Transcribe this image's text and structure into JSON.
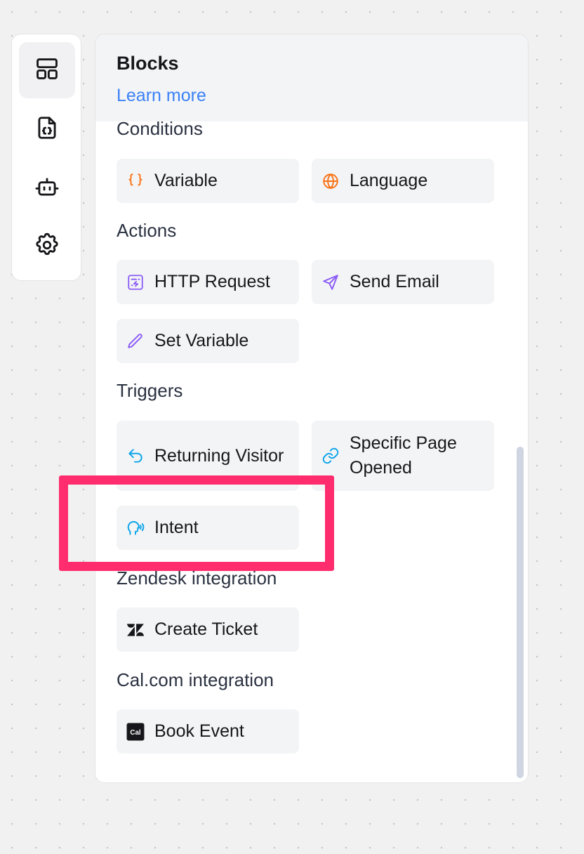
{
  "rail": {
    "items": [
      {
        "name": "blocks",
        "icon": "layout-icon",
        "active": true
      },
      {
        "name": "variables",
        "icon": "code-file-icon",
        "active": false
      },
      {
        "name": "bot",
        "icon": "bot-icon",
        "active": false
      },
      {
        "name": "settings",
        "icon": "gear-icon",
        "active": false
      }
    ]
  },
  "panel": {
    "title": "Blocks",
    "learn_more": "Learn more"
  },
  "sections": {
    "conditions": {
      "label": "Conditions",
      "blocks": [
        {
          "label": "Variable",
          "icon": "braces-icon",
          "color": "#f97316"
        },
        {
          "label": "Language",
          "icon": "globe-icon",
          "color": "#f97316"
        }
      ]
    },
    "actions": {
      "label": "Actions",
      "blocks": [
        {
          "label": "HTTP Request",
          "icon": "http-request-icon",
          "color": "#8b5cf6"
        },
        {
          "label": "Send Email",
          "icon": "send-icon",
          "color": "#8b5cf6"
        },
        {
          "label": "Set Variable",
          "icon": "pencil-icon",
          "color": "#8b5cf6"
        }
      ]
    },
    "triggers": {
      "label": "Triggers",
      "blocks": [
        {
          "label": "Returning Visitor",
          "icon": "undo-arrow-icon",
          "color": "#0ea5e9"
        },
        {
          "label": "Specific Page Opened",
          "icon": "link-icon",
          "color": "#0ea5e9"
        },
        {
          "label": "Intent",
          "icon": "speaking-head-icon",
          "color": "#0ea5e9"
        }
      ]
    },
    "zendesk": {
      "label": "Zendesk integration",
      "blocks": [
        {
          "label": "Create Ticket",
          "icon": "zendesk-logo-icon",
          "color": "#17171b"
        }
      ]
    },
    "calcom": {
      "label": "Cal.com integration",
      "blocks": [
        {
          "label": "Book Event",
          "icon": "cal-logo-icon",
          "color": "#17171b",
          "logo_text": "Cal"
        }
      ]
    }
  },
  "highlight_color": "#ff2d6d"
}
